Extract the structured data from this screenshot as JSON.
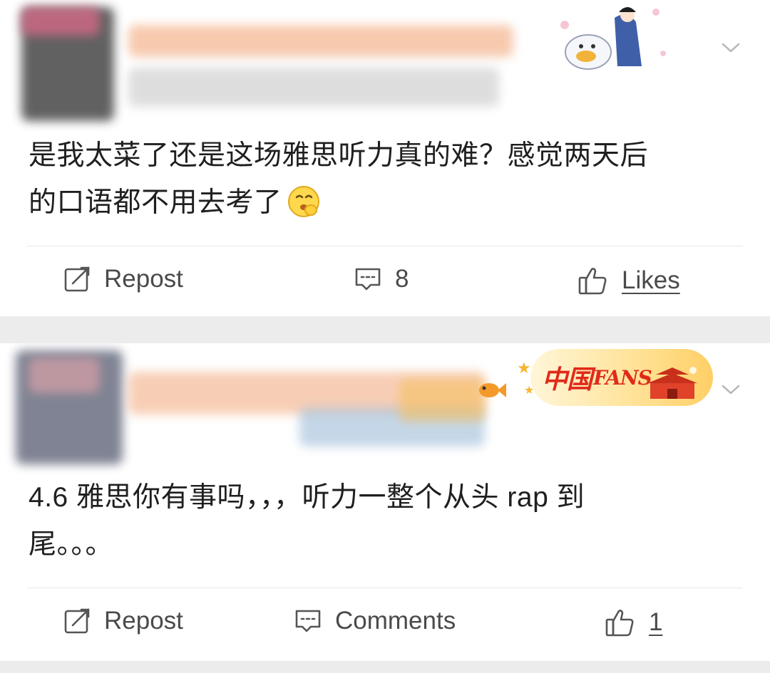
{
  "feed": {
    "comments": [
      {
        "body_line1": "是我太菜了还是这场雅思听力真的难？感觉两天后",
        "body_line2": "的口语都不用去考了",
        "emoji": "smiling-face-emoji",
        "actions": {
          "repost_label": "Repost",
          "comments_label": "8",
          "likes_label": "Likes"
        }
      },
      {
        "body_line1": "4.6 雅思你有事吗，，，听力一整个从头 rap 到",
        "body_line2": "尾。。。",
        "badge": {
          "title": "中国",
          "subtitle": "FANS"
        },
        "actions": {
          "repost_label": "Repost",
          "comments_label": "Comments",
          "likes_label": "1"
        }
      }
    ]
  },
  "colors": {
    "background": "#ececec",
    "card": "#ffffff",
    "text": "#1f1f1f",
    "action_text": "#4a4a4a",
    "badge_red": "#e02a1a"
  },
  "icons": [
    "chevron-down-icon",
    "repost-icon",
    "comment-icon",
    "thumbs-up-icon"
  ]
}
